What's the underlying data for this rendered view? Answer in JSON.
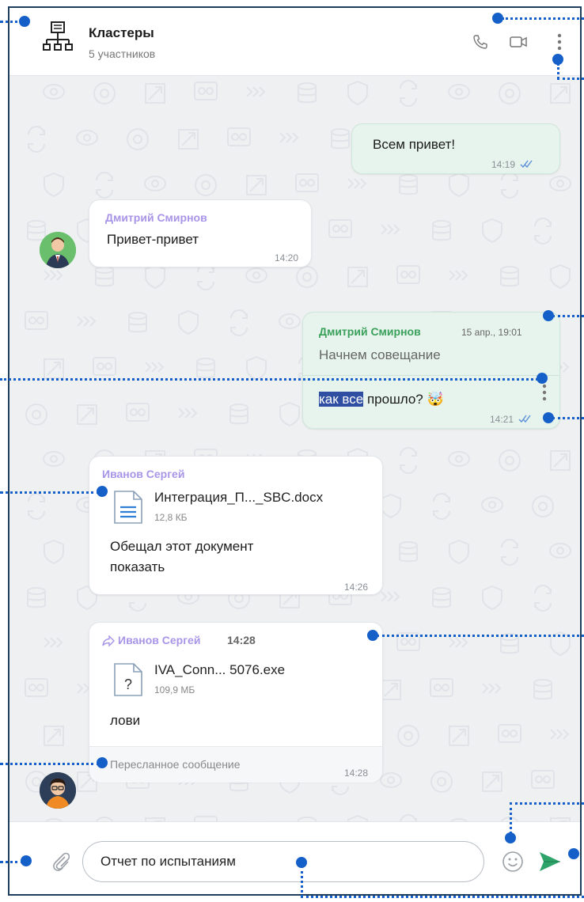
{
  "header": {
    "title": "Кластеры",
    "subtitle": "5 участников",
    "icons": [
      "network-group-icon",
      "phone-icon",
      "video-icon",
      "more-vertical-icon"
    ]
  },
  "messages": [
    {
      "id": "m1",
      "direction": "out",
      "text": "Всем привет!",
      "time": "14:19",
      "status": "read"
    },
    {
      "id": "m2",
      "direction": "in",
      "sender": "Дмитрий Смирнов",
      "text": "Привет-привет",
      "time": "14:20"
    },
    {
      "id": "m3",
      "direction": "out",
      "reply": {
        "sender": "Дмитрий Смирнов",
        "date": "15 апр., 19:01",
        "text": "Начнем совещание"
      },
      "text_highlight": "как все",
      "text_rest": " прошло? 🤯",
      "time": "14:21",
      "status": "read"
    },
    {
      "id": "m4",
      "direction": "in",
      "sender": "Иванов Сергей",
      "file": {
        "name": "Интеграция_П..._SBC.docx",
        "size": "12,8 КБ",
        "icon": "document-icon"
      },
      "text_line1": "Обещал этот документ",
      "text_line2": "показать",
      "time": "14:26"
    },
    {
      "id": "m5",
      "direction": "in",
      "forwarded_from": "Иванов Сергей",
      "forwarded_time": "14:28",
      "file": {
        "name": "IVA_Conn... 5076.exe",
        "size": "109,9 МБ",
        "icon": "unknown-file-icon"
      },
      "text": "лови",
      "footer_label": "Пересланное сообщение",
      "time": "14:28"
    }
  ],
  "composer": {
    "value": "Отчет по испытаниям",
    "icons": [
      "attach-icon",
      "emoji-icon",
      "send-icon"
    ]
  },
  "colors": {
    "outgoing_bubble": "#e7f4ee",
    "incoming_bubble": "#ffffff",
    "sender_purple": "#a895e8",
    "sender_green": "#3aa05a",
    "send_green": "#2ea36a",
    "annotation_blue": "#1560c8"
  }
}
